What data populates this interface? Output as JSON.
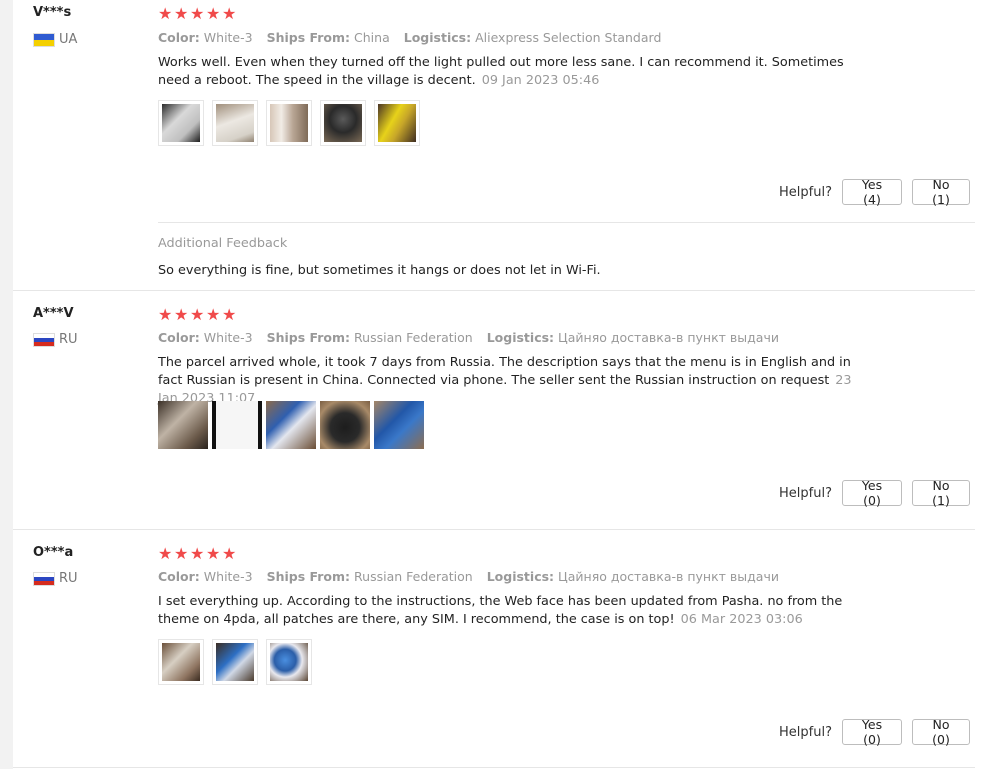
{
  "helpful_label": "Helpful?",
  "labels": {
    "color": "Color:",
    "ships_from": "Ships From:",
    "logistics": "Logistics:"
  },
  "colors": {
    "star": "#f04a4a"
  },
  "reviews": [
    {
      "user": "V***s",
      "country_code": "UA",
      "rating": 5,
      "color": "White-3",
      "ships_from": "China",
      "logistics": "Aliexpress Selection Standard",
      "text": "Works well. Even when they turned off the light pulled out more less sane. I can recommend it. Sometimes need a reboot. The speed in the village is decent.",
      "date": "09 Jan 2023 05:46",
      "images": 5,
      "yes": "Yes (4)",
      "no": "No (1)",
      "additional_title": "Additional Feedback",
      "additional_text": "So everything is fine, but sometimes it hangs or does not let in Wi-Fi."
    },
    {
      "user": "A***V",
      "country_code": "RU",
      "rating": 5,
      "color": "White-3",
      "ships_from": "Russian Federation",
      "logistics": "Цайняо доставка-в пункт выдачи",
      "text": "The parcel arrived whole, it took 7 days from Russia. The description says that the menu is in English and in fact Russian is present in China. Connected via phone. The seller sent the Russian instruction on request",
      "date": "23 Jan 2023 11:07",
      "images": 5,
      "yes": "Yes (0)",
      "no": "No (1)"
    },
    {
      "user": "O***a",
      "country_code": "RU",
      "rating": 5,
      "color": "White-3",
      "ships_from": "Russian Federation",
      "logistics": "Цайняо доставка-в пункт выдачи",
      "text": "I set everything up. According to the instructions, the Web face has been updated from Pasha. no from the theme on 4pda, all patches are there, any SIM. I recommend, the case is on top!",
      "date": "06 Mar 2023 03:06",
      "images": 3,
      "yes": "Yes (0)",
      "no": "No (0)"
    }
  ]
}
